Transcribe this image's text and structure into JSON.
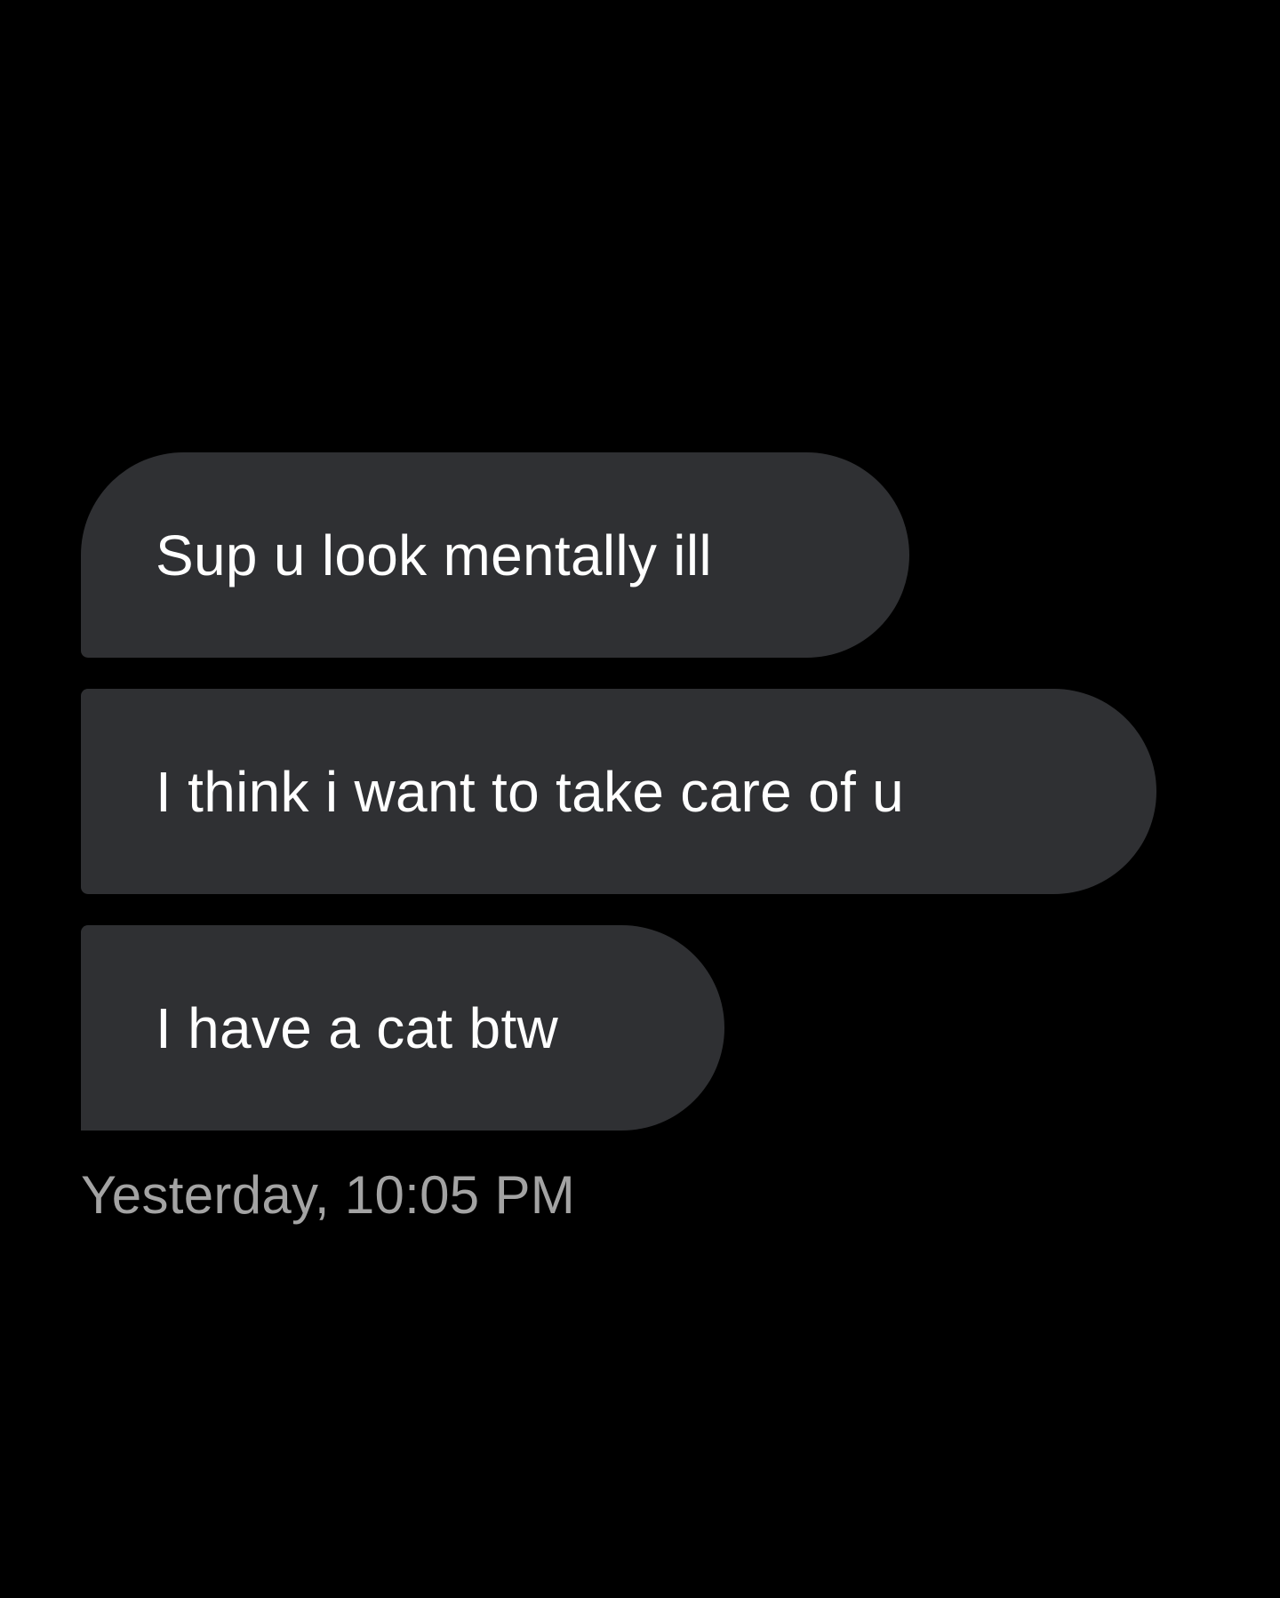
{
  "messages": [
    {
      "text": "Sup u look mentally ill"
    },
    {
      "text": "I think i want to take care of u"
    },
    {
      "text": "I have a cat btw"
    }
  ],
  "timestamp": "Yesterday, 10:05 PM",
  "colors": {
    "background": "#000000",
    "bubble": "#2f3033",
    "message_text": "#ffffff",
    "timestamp_text": "#a3a3a3"
  }
}
